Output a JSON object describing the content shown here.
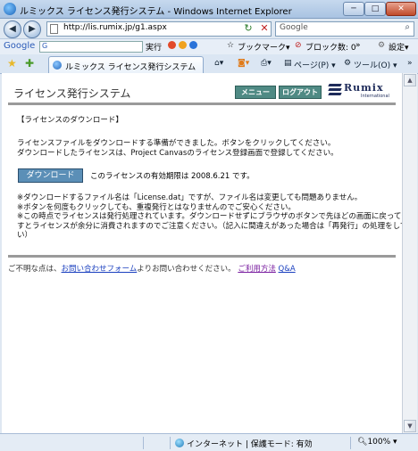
{
  "window": {
    "title": "ルミックス ライセンス発行システム - Windows Internet Explorer",
    "minimize_symbol": "─",
    "maximize_symbol": "□",
    "close_symbol": "✕"
  },
  "address_bar": {
    "url": "http://lis.rumix.jp/g1.aspx",
    "search_placeholder": "Google"
  },
  "google_toolbar": {
    "logo": "Google",
    "input_prefix": "G",
    "run_label": "実行",
    "bookmarks_label": "ブックマーク▾",
    "block_label": "ブロック数: 0",
    "more": "»",
    "settings_label": "設定▾"
  },
  "tab_bar": {
    "tab_title": "ルミックス ライセンス発行システム",
    "page_menu": "ページ(P) ▾",
    "tools_menu": "ツール(O) ▾",
    "more": "»"
  },
  "page": {
    "title": "ライセンス発行システム",
    "menu_button": "メニュー",
    "logout_button": "ログアウト",
    "logo": {
      "brand": "Rumix",
      "sub": "International"
    },
    "section_heading": "【ライセンスのダウンロード】",
    "intro_lines": [
      "ライセンスファイルをダウンロードする準備ができました。ボタンをクリックしてください。",
      "ダウンロードしたライセンスは、Project Canvasのライセンス登録画面で登録してください。"
    ],
    "download_button": "ダウンロード",
    "expiry_text": "このライセンスの有効期限は 2008.6.21 です。",
    "notes": [
      "※ダウンロードするファイル名は「License.dat」ですが、ファイル名は変更しても問題ありません。",
      "※ボタンを何度もクリックしても、重複発行とはなりませんのでご安心ください。",
      "※この時点でライセンスは発行処理されています。ダウンロードせずにブラウザのボタンで先ほどの画面に戻ってやり直",
      "すとライセンスが余分に消費されますのでご注意ください。（記入に間違えがあった場合は「再発行」の処理をしてくださ",
      "い）"
    ],
    "footer": {
      "prefix": "ご不明な点は、",
      "contact_link": "お問い合わせフォーム",
      "middle": "よりお問い合わせください。",
      "terms_link": "ご利用方法",
      "qa_link": "Q&A"
    }
  },
  "status_bar": {
    "zone": "インターネット | 保護モード: 有効",
    "zoom": "100% ▾"
  }
}
